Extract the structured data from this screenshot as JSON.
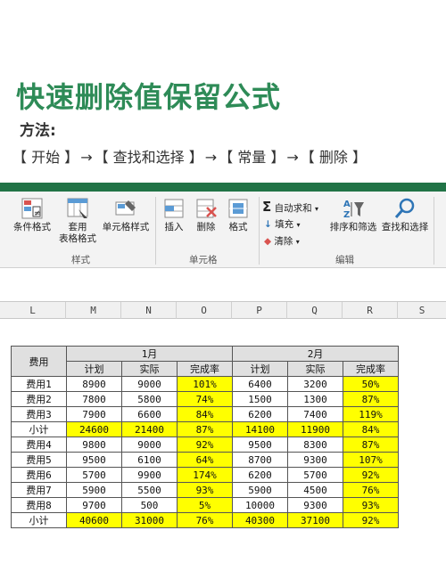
{
  "title": "快速删除值保留公式",
  "method_label": "方法:",
  "steps": [
    "【 开始 】",
    "→",
    "【 查找和选择 】",
    "→",
    "【 常量 】",
    "→",
    "【 删除 】"
  ],
  "ribbon": {
    "conditional_format": "条件格式",
    "apply_table": "套用",
    "table_format": "表格格式",
    "cell_style": "单元格样式",
    "styles_group": "样式",
    "insert": "插入",
    "delete": "删除",
    "format": "格式",
    "cells_group": "单元格",
    "autosum": "自动求和",
    "fill": "填充",
    "clear": "清除",
    "sort_filter": "排序和筛选",
    "find_select": "查找和选择",
    "edit_group": "编辑"
  },
  "columns": [
    "L",
    "M",
    "N",
    "O",
    "P",
    "Q",
    "R",
    "S"
  ],
  "table": {
    "corner": "费用",
    "month1": "1月",
    "month2": "2月",
    "sub": [
      "计划",
      "实际",
      "完成率",
      "计划",
      "实际",
      "完成率"
    ],
    "rows": [
      {
        "label": "费用1",
        "v": [
          "8900",
          "9000",
          "101%",
          "6400",
          "3200",
          "50%"
        ]
      },
      {
        "label": "费用2",
        "v": [
          "7800",
          "5800",
          "74%",
          "1500",
          "1300",
          "87%"
        ]
      },
      {
        "label": "费用3",
        "v": [
          "7900",
          "6600",
          "84%",
          "6200",
          "7400",
          "119%"
        ]
      },
      {
        "label": "小计",
        "v": [
          "24600",
          "21400",
          "87%",
          "14100",
          "11900",
          "84%"
        ]
      },
      {
        "label": "费用4",
        "v": [
          "9800",
          "9000",
          "92%",
          "9500",
          "8300",
          "87%"
        ]
      },
      {
        "label": "费用5",
        "v": [
          "9500",
          "6100",
          "64%",
          "8700",
          "9300",
          "107%"
        ]
      },
      {
        "label": "费用6",
        "v": [
          "5700",
          "9900",
          "174%",
          "6200",
          "5700",
          "92%"
        ]
      },
      {
        "label": "费用7",
        "v": [
          "5900",
          "5500",
          "93%",
          "5900",
          "4500",
          "76%"
        ]
      },
      {
        "label": "费用8",
        "v": [
          "9700",
          "500",
          "5%",
          "10000",
          "9300",
          "93%"
        ]
      },
      {
        "label": "小计",
        "v": [
          "40600",
          "31000",
          "76%",
          "40300",
          "37100",
          "92%"
        ]
      }
    ]
  },
  "colors": {
    "accent": "#2e8b57",
    "ribbon_green": "#217346",
    "highlight": "#ffff00"
  }
}
